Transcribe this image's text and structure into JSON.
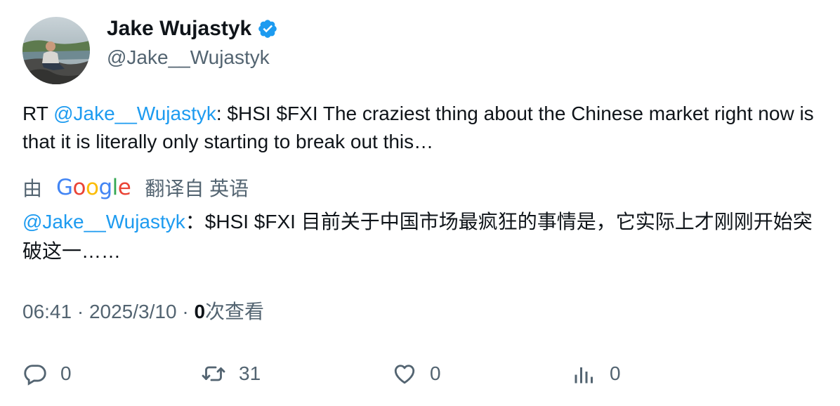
{
  "author": {
    "display_name": "Jake Wujastyk",
    "handle": "@Jake__Wujastyk",
    "verified": true,
    "avatar_icon": "avatar-photo-person-on-rocks"
  },
  "tweet": {
    "prefix": "RT ",
    "mention": "@Jake__Wujastyk",
    "text_line": ": $HSI $FXI The craziest thing about the Chinese market right now is that it is literally only starting to break out this…"
  },
  "translation": {
    "by_label": "由",
    "google_logo": "Google",
    "translated_from_label": "翻译自 英语",
    "mention": "@Jake__Wujastyk",
    "text": "：$HSI $FXI 目前关于中国市场最疯狂的事情是，它实际上才刚刚开始突破这一……"
  },
  "meta": {
    "time": "06:41",
    "separator": " · ",
    "date": "2025/3/10",
    "views_count": "0",
    "views_label": "次查看"
  },
  "actions": {
    "reply_count": "0",
    "retweet_count": "31",
    "like_count": "0",
    "analytics_count": "0"
  },
  "colors": {
    "link": "#1d9bf0",
    "secondary_text": "#536471",
    "primary_text": "#0f1419",
    "verified_badge": "#1d9bf0"
  }
}
